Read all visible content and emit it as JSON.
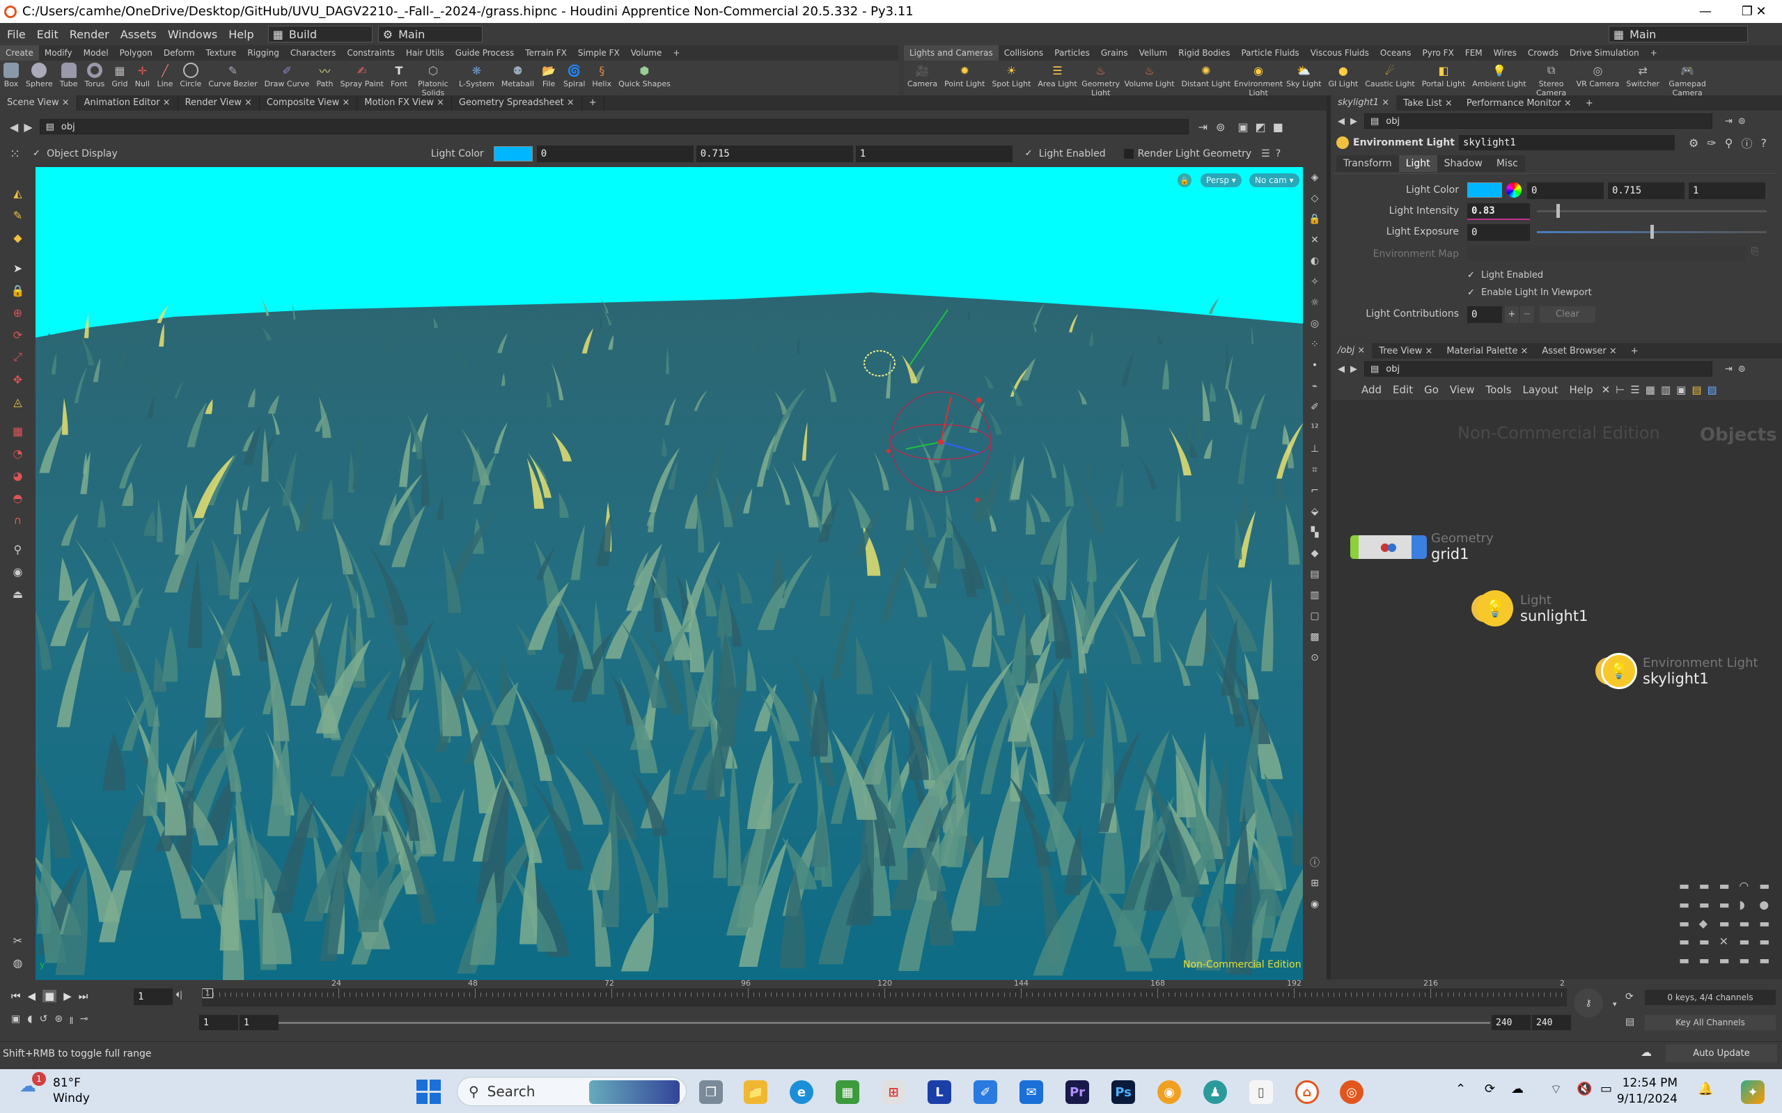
{
  "window": {
    "title": "C:/Users/camhe/OneDrive/Desktop/GitHub/UVU_DAGV2210-_-Fall-_-2024-/grass.hipnc - Houdini Apprentice Non-Commercial 20.5.332 - Py3.11",
    "minimize": "—",
    "maximize": "❐",
    "close": "✕"
  },
  "menu": {
    "items": [
      "File",
      "Edit",
      "Render",
      "Assets",
      "Windows",
      "Help"
    ],
    "desktop": "Build",
    "desktop_right": "Main",
    "context": "Main"
  },
  "shelf_left": {
    "tabs": [
      "Create",
      "Modify",
      "Model",
      "Polygon",
      "Deform",
      "Texture",
      "Rigging",
      "Characters",
      "Constraints",
      "Hair Utils",
      "Guide Process",
      "Terrain FX",
      "Simple FX",
      "Volume"
    ],
    "tools": [
      "Box",
      "Sphere",
      "Tube",
      "Torus",
      "Grid",
      "Null",
      "Line",
      "Circle",
      "Curve Bezier",
      "Draw Curve",
      "Path",
      "Spray Paint",
      "Font",
      "Platonic Solids",
      "L-System",
      "Metaball",
      "File",
      "Spiral",
      "Helix",
      "Quick Shapes"
    ]
  },
  "shelf_right": {
    "tabs": [
      "Lights and Cameras",
      "Collisions",
      "Particles",
      "Grains",
      "Vellum",
      "Rigid Bodies",
      "Particle Fluids",
      "Viscous Fluids",
      "Oceans",
      "Pyro FX",
      "FEM",
      "Wires",
      "Crowds",
      "Drive Simulation"
    ],
    "tools": [
      "Camera",
      "Point Light",
      "Spot Light",
      "Area Light",
      "Geometry Light",
      "Volume Light",
      "Distant Light",
      "Environment Light",
      "Sky Light",
      "GI Light",
      "Caustic Light",
      "Portal Light",
      "Ambient Light",
      "Stereo Camera",
      "VR Camera",
      "Switcher",
      "Gamepad Camera"
    ]
  },
  "left_pane": {
    "tabs": [
      "Scene View",
      "Animation Editor",
      "Render View",
      "Composite View",
      "Motion FX View",
      "Geometry Spreadsheet"
    ],
    "path": "obj"
  },
  "viewport_options": {
    "object_display": "Object Display",
    "light_color_label": "Light Color",
    "r": "0",
    "g": "0.715",
    "b": "1",
    "light_enabled": "Light Enabled",
    "render_light_geometry": "Render Light Geometry",
    "persp": "Persp ▾",
    "no_cam": "No cam ▾",
    "watermark": "Non-Commercial Edition",
    "sky_color": "#00ffff"
  },
  "params_pane": {
    "tabs": [
      "skylight1",
      "Take List",
      "Performance Monitor"
    ],
    "path": "obj",
    "node_type": "Environment Light",
    "node_name": "skylight1",
    "param_tabs": [
      "Transform",
      "Light",
      "Shadow",
      "Misc"
    ],
    "light_color_label": "Light Color",
    "r": "0",
    "g": "0.715",
    "b": "1",
    "intensity_label": "Light Intensity",
    "intensity": "0.83",
    "exposure_label": "Light Exposure",
    "exposure": "0",
    "env_map_label": "Environment Map",
    "light_enabled": "Light Enabled",
    "enable_viewport": "Enable Light In Viewport",
    "contrib_label": "Light Contributions",
    "contrib": "0",
    "clear": "Clear"
  },
  "network_pane": {
    "tabs": [
      "/obj",
      "Tree View",
      "Material Palette",
      "Asset Browser"
    ],
    "path": "obj",
    "menus": [
      "Add",
      "Edit",
      "Go",
      "View",
      "Tools",
      "Layout",
      "Help"
    ],
    "watermark": "Non-Commercial Edition",
    "context_label": "Objects",
    "nodes": [
      {
        "type": "Geometry",
        "name": "grid1"
      },
      {
        "type": "Light",
        "name": "sunlight1"
      },
      {
        "type": "Environment Light",
        "name": "skylight1"
      }
    ]
  },
  "timeline": {
    "frame": "1",
    "ticks": [
      "24",
      "48",
      "72",
      "96",
      "120",
      "144",
      "168",
      "192",
      "216",
      "2"
    ],
    "start": "1",
    "start2": "1",
    "end": "240",
    "end2": "240",
    "keys": "0 keys, 4/4 channels",
    "key_all": "Key All Channels",
    "auto_update": "Auto Update"
  },
  "status": {
    "hint": "Shift+RMB to toggle full range"
  },
  "taskbar": {
    "temperature": "81°F",
    "weather": "Windy",
    "badge": "1",
    "search": "Search",
    "time": "12:54 PM",
    "date": "9/11/2024"
  }
}
